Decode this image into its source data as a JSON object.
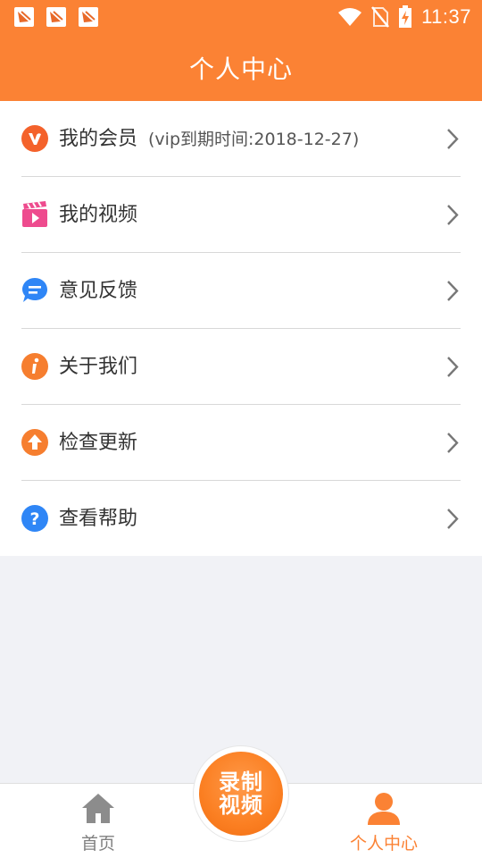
{
  "status_bar": {
    "time": "11:37",
    "icons": [
      "app-notification-icon",
      "app-notification-icon",
      "app-notification-icon",
      "wifi-icon",
      "no-sim-icon",
      "battery-charging-icon"
    ]
  },
  "header": {
    "title": "个人中心"
  },
  "menu": {
    "items": [
      {
        "label": "我的会员",
        "sub": "(vip到期时间:2018-12-27)",
        "icon": "vip-icon",
        "color": "#f4622b"
      },
      {
        "label": "我的视频",
        "sub": "",
        "icon": "video-clapper-icon",
        "color": "#ee4b8e"
      },
      {
        "label": "意见反馈",
        "sub": "",
        "icon": "feedback-chat-icon",
        "color": "#2f86f6"
      },
      {
        "label": "关于我们",
        "sub": "",
        "icon": "info-icon",
        "color": "#f67e2f"
      },
      {
        "label": "检查更新",
        "sub": "",
        "icon": "upload-arrow-icon",
        "color": "#f67e2f"
      },
      {
        "label": "查看帮助",
        "sub": "",
        "icon": "help-question-icon",
        "color": "#2f86f6"
      }
    ]
  },
  "tabbar": {
    "home_label": "首页",
    "record_label": "录制视频",
    "me_label": "个人中心",
    "active_color": "#fb8234",
    "inactive_color": "#808080"
  },
  "colors": {
    "accent": "#fb8234",
    "background": "#f1f2f6"
  }
}
